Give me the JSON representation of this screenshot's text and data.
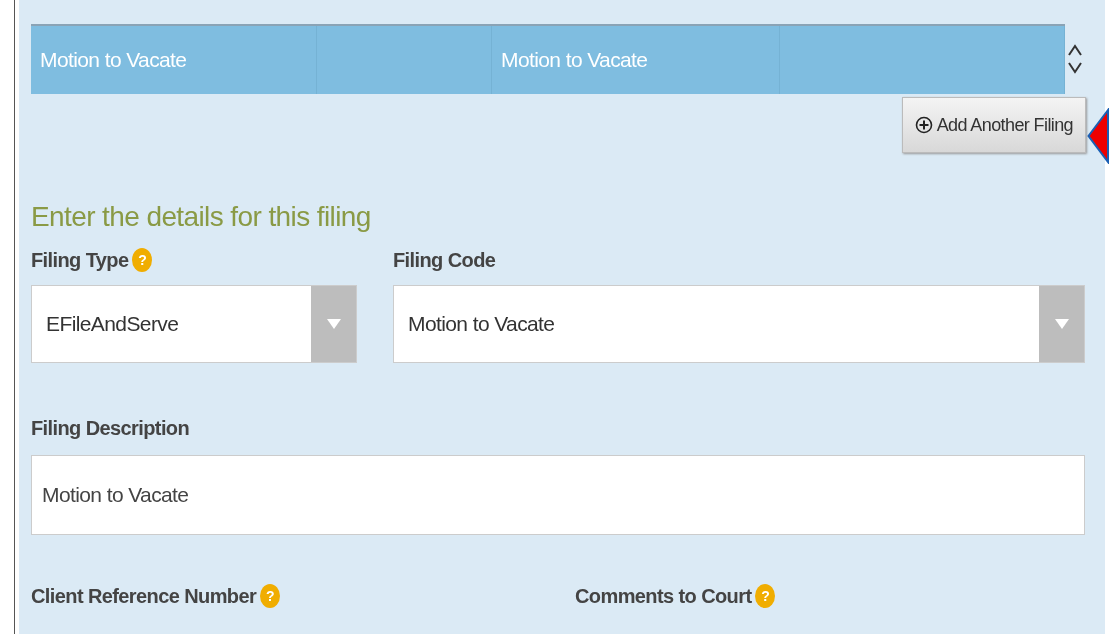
{
  "filings_table": {
    "rows": [
      {
        "cells": [
          "Motion to Vacate",
          "",
          "Motion to Vacate",
          ""
        ],
        "selected": true
      }
    ]
  },
  "add_button": {
    "label": "Add Another Filing"
  },
  "details": {
    "heading": "Enter the details for this filing",
    "filing_type": {
      "label": "Filing Type",
      "help": "?",
      "value": "EFileAndServe"
    },
    "filing_code": {
      "label": "Filing Code",
      "value": "Motion to Vacate"
    },
    "filing_description": {
      "label": "Filing Description",
      "value": "Motion to Vacate"
    },
    "client_reference": {
      "label": "Client Reference Number",
      "help": "?"
    },
    "comments": {
      "label": "Comments to Court",
      "help": "?"
    }
  }
}
